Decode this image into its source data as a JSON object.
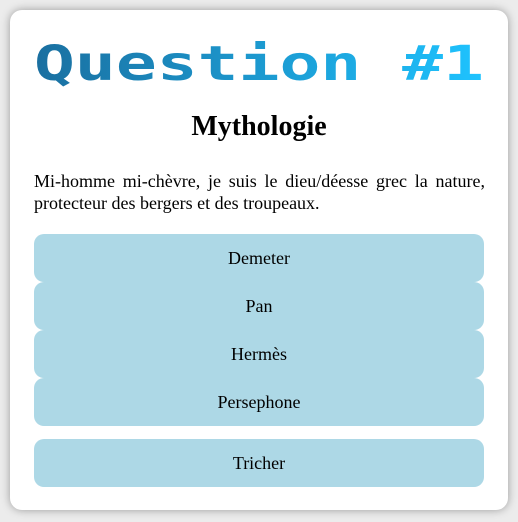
{
  "title": "Question #1",
  "category": "Mythologie",
  "question": "Mi-homme mi-chèvre, je suis le dieu/déesse grec la nature, protecteur des bergers et des troupeaux.",
  "answers": [
    "Demeter",
    "Pan",
    "Hermès",
    "Persephone"
  ],
  "cheat_label": "Tricher",
  "colors": {
    "title_gradient_start": "#1a6fa0",
    "title_gradient_end": "#1ec3ff",
    "button": "#add8e6",
    "card": "#ffffff"
  }
}
